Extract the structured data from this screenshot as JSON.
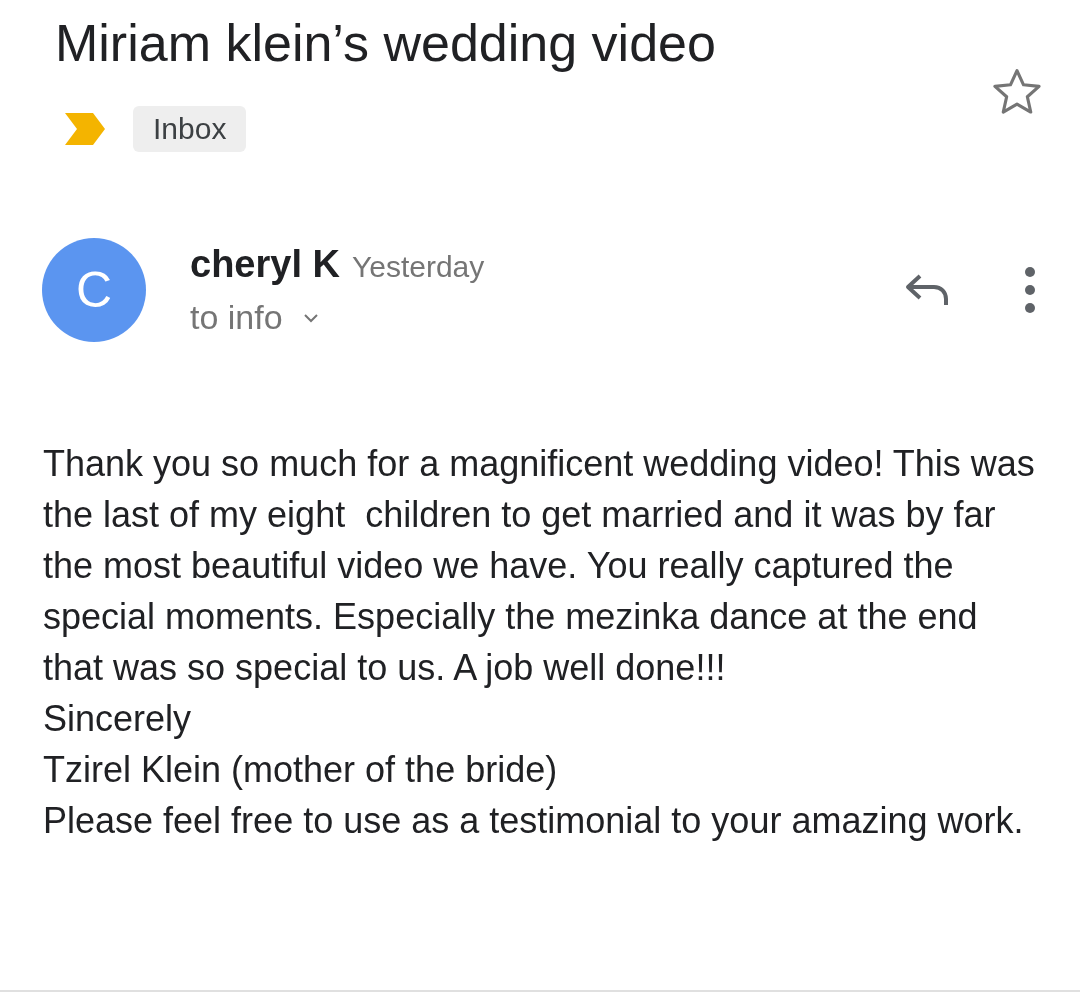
{
  "subject": {
    "title": "Miriam klein’s wedding video",
    "starred": false
  },
  "important": true,
  "labels": [
    {
      "text": "Inbox"
    }
  ],
  "message": {
    "avatar_letter": "C",
    "sender": "cheryl K",
    "time": "Yesterday",
    "recipient": "to info",
    "body": "Thank you so much for a magnificent wedding video! This was the last of my eight  children to get married and it was by far the most beautiful video we have. You really captured the special moments. Especially the mezinka dance at the end that was so special to us. A job well done!!!\nSincerely\nTzirel Klein (mother of the bride)\nPlease feel free to use as a testimonial to your amazing work."
  }
}
